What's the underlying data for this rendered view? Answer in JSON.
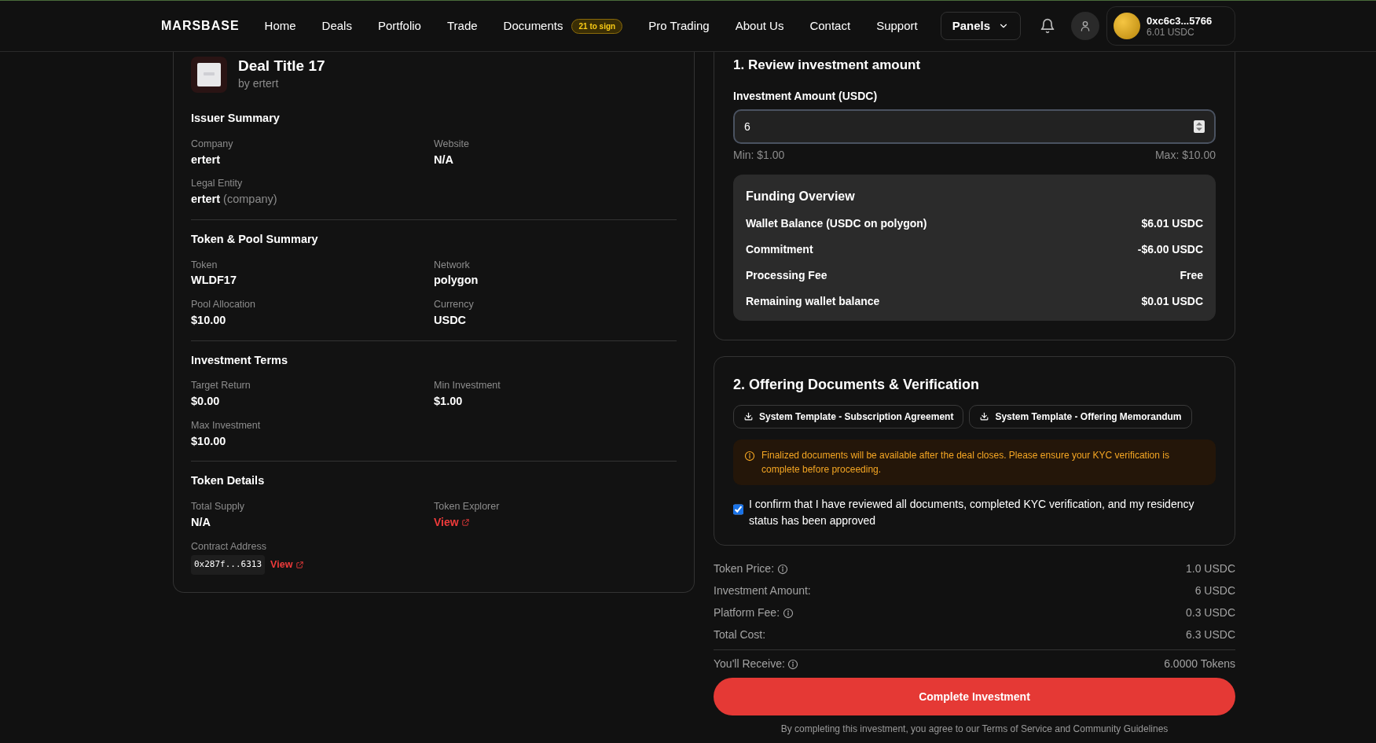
{
  "navbar": {
    "logo": "MARSBASE",
    "links": [
      {
        "label": "Home"
      },
      {
        "label": "Deals"
      },
      {
        "label": "Portfolio"
      },
      {
        "label": "Trade"
      },
      {
        "label": "Documents",
        "badge": "21 to sign"
      },
      {
        "label": "Pro Trading"
      },
      {
        "label": "About Us"
      },
      {
        "label": "Contact"
      },
      {
        "label": "Support"
      }
    ],
    "panels_button": "Panels",
    "wallet": {
      "address": "0xc6c3...5766",
      "balance": "6.01 USDC"
    }
  },
  "deal": {
    "title": "Deal Title 17",
    "by": "by ertert",
    "sections": [
      {
        "title": "Issuer Summary",
        "fields": [
          {
            "kind": "text",
            "label": "Company",
            "value": "ertert"
          },
          {
            "kind": "text",
            "label": "Website",
            "value": "N/A"
          },
          {
            "kind": "entity",
            "label": "Legal Entity",
            "value": "ertert",
            "note": "(company)"
          }
        ]
      },
      {
        "title": "Token & Pool Summary",
        "fields": [
          {
            "kind": "text",
            "label": "Token",
            "value": "WLDF17"
          },
          {
            "kind": "text",
            "label": "Network",
            "value": "polygon"
          },
          {
            "kind": "text",
            "label": "Pool Allocation",
            "value": "$10.00"
          },
          {
            "kind": "text",
            "label": "Currency",
            "value": "USDC"
          }
        ]
      },
      {
        "title": "Investment Terms",
        "fields": [
          {
            "kind": "text",
            "label": "Target Return",
            "value": "$0.00"
          },
          {
            "kind": "text",
            "label": "Min Investment",
            "value": "$1.00"
          },
          {
            "kind": "text",
            "label": "Max Investment",
            "value": "$10.00"
          }
        ]
      },
      {
        "title": "Token Details",
        "fields": [
          {
            "kind": "text",
            "label": "Total Supply",
            "value": "N/A"
          },
          {
            "kind": "link",
            "label": "Token Explorer",
            "value": "View"
          },
          {
            "kind": "code",
            "label": "Contract Address",
            "value": "0x287f...6313",
            "link": "View"
          }
        ]
      }
    ]
  },
  "review": {
    "title": "1. Review investment amount",
    "input_label": "Investment Amount (USDC)",
    "input_value": "6",
    "min": "Min: $1.00",
    "max": "Max: $10.00",
    "funding": {
      "title": "Funding Overview",
      "rows": [
        {
          "label": "Wallet Balance (USDC on polygon)",
          "value": "$6.01 USDC"
        },
        {
          "label": "Commitment",
          "value": "-$6.00 USDC"
        },
        {
          "label": "Processing Fee",
          "value": "Free"
        },
        {
          "label": "Remaining wallet balance",
          "value": "$0.01 USDC"
        }
      ]
    }
  },
  "documents": {
    "title": "2. Offering Documents & Verification",
    "buttons": [
      "System Template - Subscription Agreement",
      "System Template - Offering Memorandum"
    ],
    "alert": "Finalized documents will be available after the deal closes. Please ensure your KYC verification is complete before proceeding.",
    "confirm": {
      "text": "I confirm that I have reviewed all documents, completed KYC verification, and my residency status has been approved",
      "checked": true
    }
  },
  "summary": {
    "rows": [
      {
        "label": "Token Price:",
        "value": "1.0 USDC",
        "info": true
      },
      {
        "label": "Investment Amount:",
        "value": "6 USDC",
        "info": false
      },
      {
        "label": "Platform Fee:",
        "value": "0.3 USDC",
        "info": true
      },
      {
        "label": "Total Cost:",
        "value": "6.3 USDC",
        "info": false
      }
    ],
    "receive": {
      "label": "You'll Receive:",
      "value": "6.0000 Tokens",
      "info": true
    },
    "button": "Complete Investment",
    "footer": "By completing this investment, you agree to our Terms of Service and Community Guidelines"
  }
}
